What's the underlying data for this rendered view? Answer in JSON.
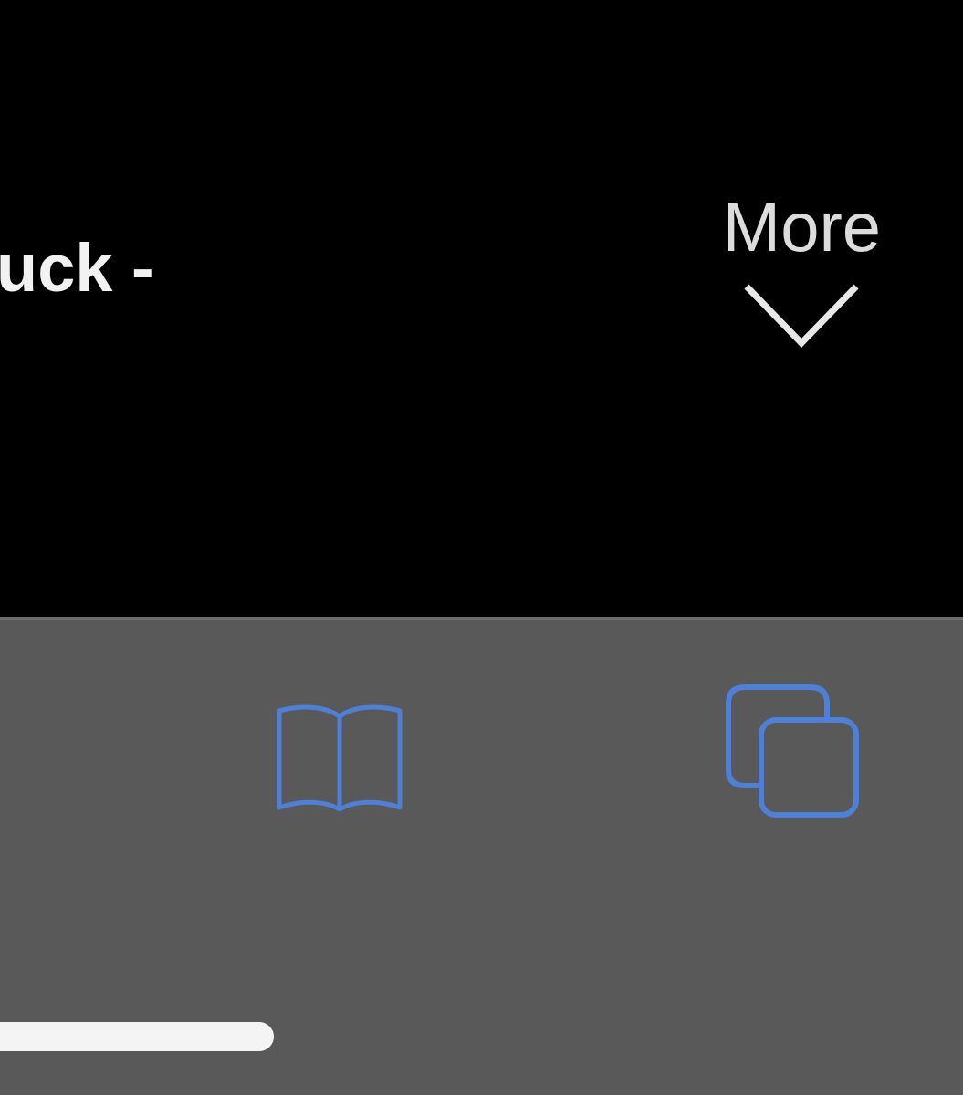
{
  "caption": "uck -",
  "more_button": {
    "label": "More"
  }
}
